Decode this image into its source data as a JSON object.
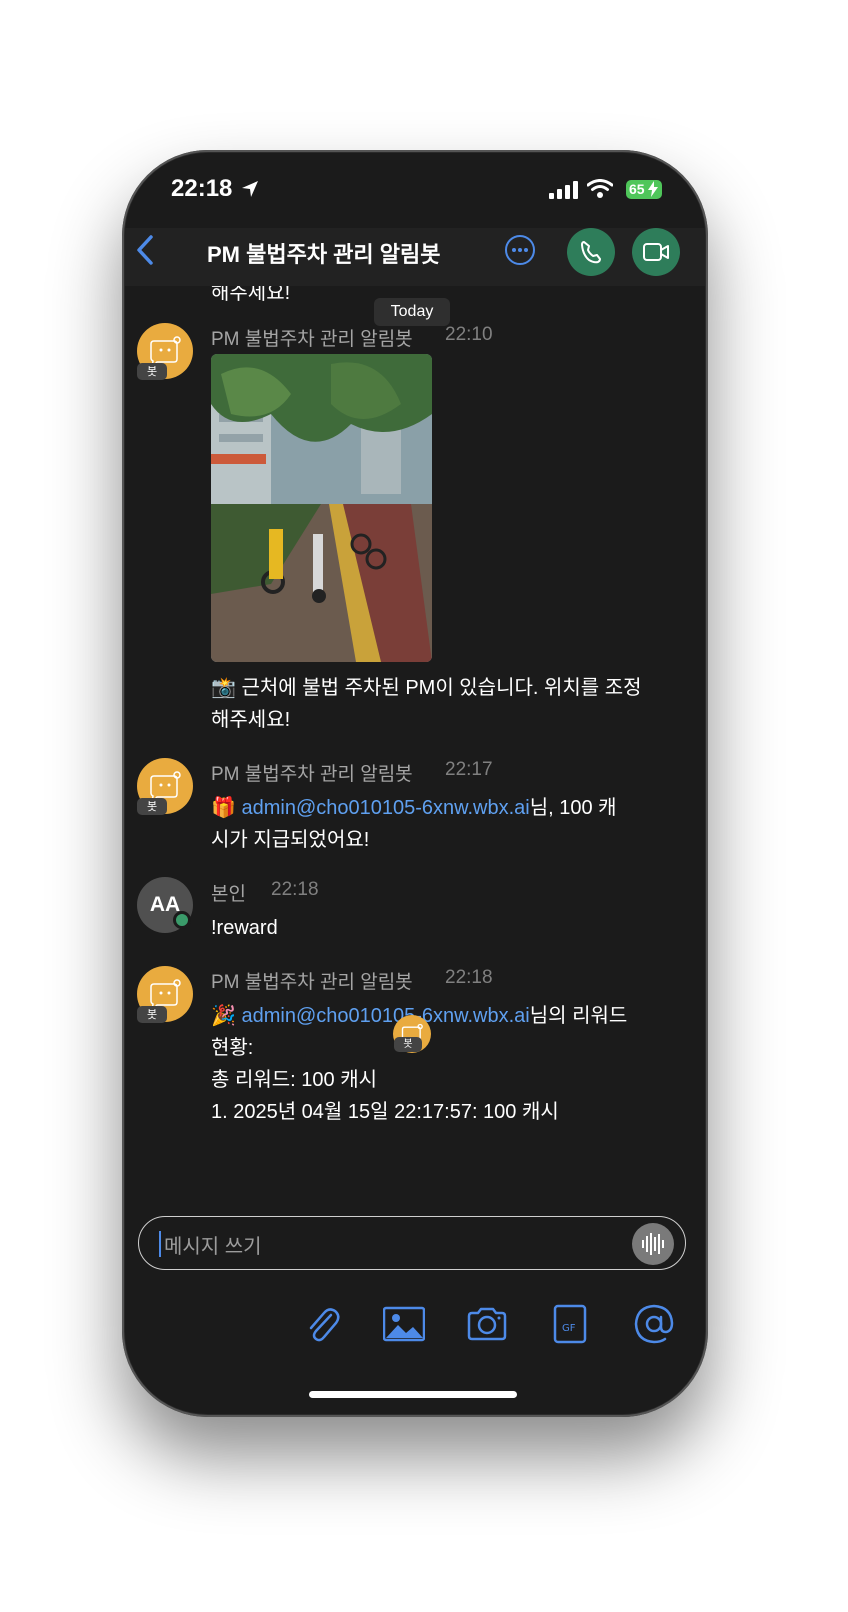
{
  "status_bar": {
    "time": "22:18",
    "battery": "65"
  },
  "header": {
    "back_icon": "chevron-left-icon",
    "title": "PM 불법주차 관리 알림봇"
  },
  "messages": {
    "cut_off_text": "해주세요!",
    "date_separator": "Today",
    "bot_badge": "봇",
    "items": [
      {
        "sender": "PM 불법주차 관리 알림봇",
        "time": "22:10",
        "attachment": "photo",
        "text": "📸 근처에 불법 주차된 PM이 있습니다. 위치를 조정\n해주세요!"
      },
      {
        "sender": "PM 불법주차 관리 알림봇",
        "time": "22:17",
        "emoji": "🎁",
        "link": "admin@cho010105-6xnw.wbx.ai",
        "text_after_link": "님, 100 캐\n시가 지급되었어요!"
      },
      {
        "sender": "본인",
        "time": "22:18",
        "avatar": "AA",
        "text": "!reward"
      },
      {
        "sender": "PM 불법주차 관리 알림봇",
        "time": "22:18",
        "emoji": "🎉",
        "link": "admin@cho010105-6xnw.wbx.ai",
        "text_after_link": "님의 리워드\n현황:\n총 리워드: 100 캐시\n1. 2025년 04월 15일 22:17:57: 100 캐시"
      }
    ]
  },
  "composer": {
    "placeholder": "메시지 쓰기"
  },
  "toolbar": {
    "gif_label": "GF"
  },
  "colors": {
    "accent": "#4d8ae8",
    "bot_avatar": "#e9ab3f",
    "call_green": "#2e7d5a",
    "background": "#1b1b1b",
    "link": "#5fa0f0"
  }
}
